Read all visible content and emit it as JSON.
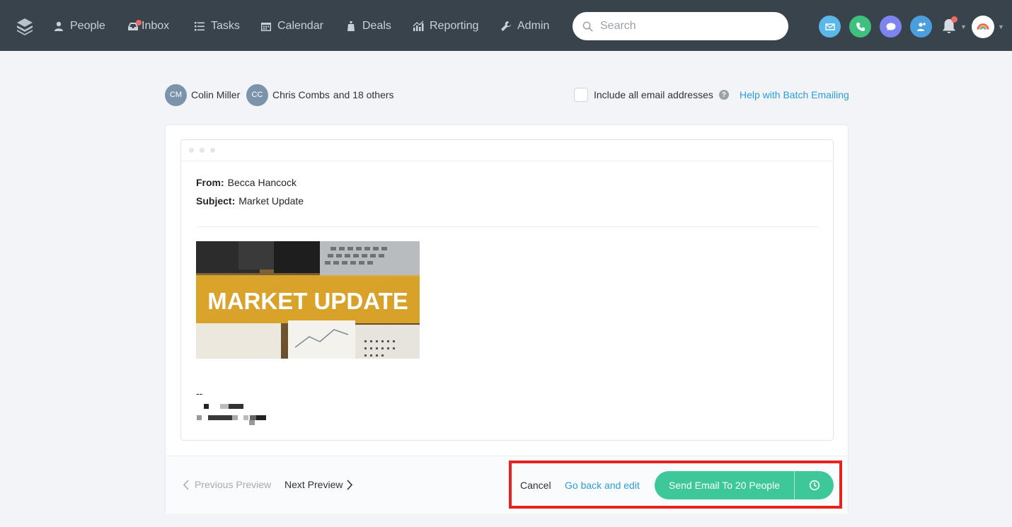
{
  "nav": {
    "items": [
      {
        "label": "People",
        "icon": "person-icon"
      },
      {
        "label": "Inbox",
        "icon": "inbox-icon"
      },
      {
        "label": "Tasks",
        "icon": "list-icon"
      },
      {
        "label": "Calendar",
        "icon": "calendar-icon"
      },
      {
        "label": "Deals",
        "icon": "deals-icon"
      },
      {
        "label": "Reporting",
        "icon": "chart-icon"
      },
      {
        "label": "Admin",
        "icon": "wrench-icon"
      }
    ],
    "search_placeholder": "Search"
  },
  "recipients": {
    "first": {
      "initials": "CM",
      "name": "Colin Miller"
    },
    "second": {
      "initials": "CC",
      "name": "Chris Combs"
    },
    "others": "and 18 others",
    "include_label": "Include all email addresses",
    "help_link": "Help with Batch Emailing"
  },
  "email": {
    "from_label": "From:",
    "from_value": "Becca Hancock",
    "subject_label": "Subject:",
    "subject_value": "Market Update",
    "banner_text": "MARKET UPDATE",
    "signature_dash": "--"
  },
  "footer": {
    "previous": "Previous Preview",
    "next": "Next Preview",
    "cancel": "Cancel",
    "go_back": "Go back and edit",
    "send": "Send Email To 20 People"
  },
  "colors": {
    "topbar": "#38434c",
    "accent_green": "#3ec89a",
    "link_blue": "#2b9ed9",
    "highlight_red": "#e8231f"
  }
}
